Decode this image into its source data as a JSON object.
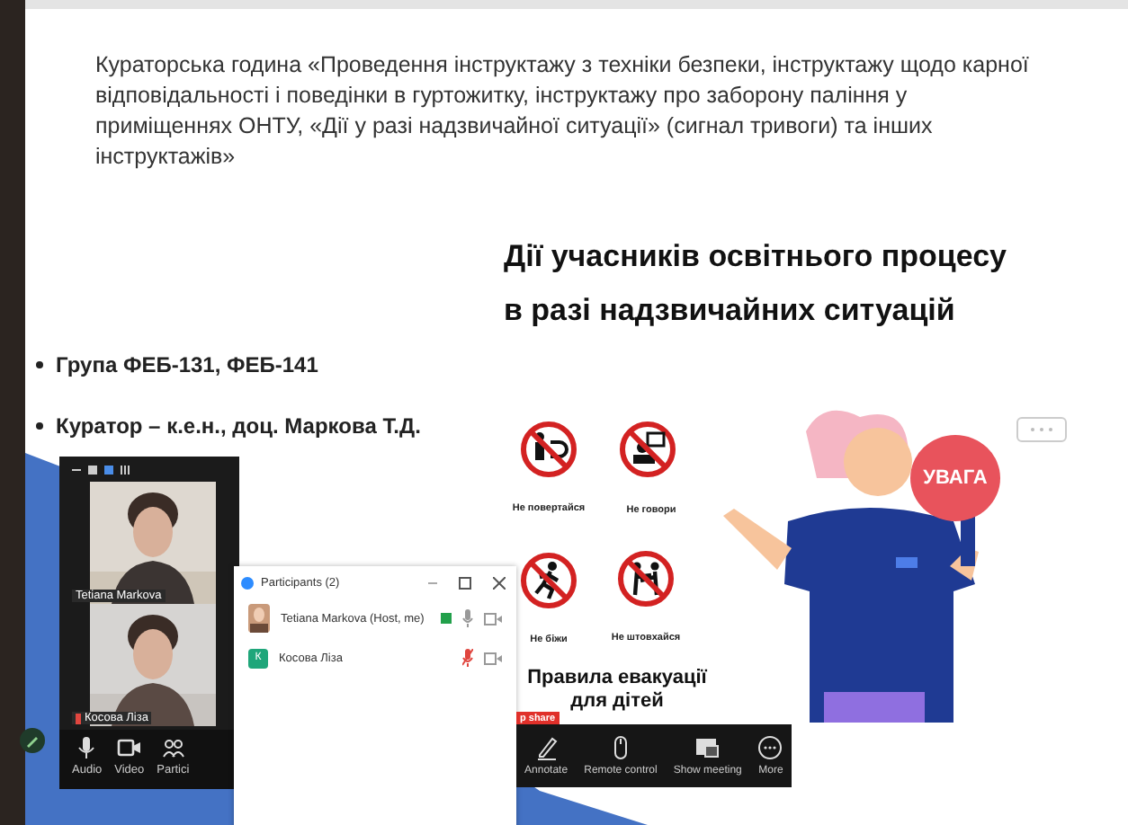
{
  "slide": {
    "intro": "Кураторська година «Проведення інструктажу з техніки безпеки, інструктажу щодо карної відповідальності і поведінки в гуртожитку, інструктажу про заборону паління у приміщеннях ОНТУ, «Дії у разі надзвичайної ситуації» (сигнал тривоги) та інших інструктажів»",
    "title": [
      "Дії учасників освітнього процесу",
      "в разі надзвичайних ситуацій"
    ],
    "bullets": [
      "Група ФЕБ-131, ФЕБ-141",
      "Куратор – к.е.н., доц. Маркова Т.Д."
    ],
    "signs": [
      {
        "kind": "turn",
        "label": "Не повертайся"
      },
      {
        "kind": "talk",
        "label": "Не говори"
      },
      {
        "kind": "run",
        "label": "Не біжи"
      },
      {
        "kind": "push",
        "label": "Не штовхайся"
      }
    ],
    "evacuation_title": "Правила евакуації для дітей",
    "poster_sign": "УВАГА"
  },
  "gallery_window": {
    "tiles": [
      {
        "name": "Tetiana Markova",
        "muted": false
      },
      {
        "name": "Косова Ліза",
        "muted": true
      }
    ],
    "controls": [
      {
        "kind": "mic",
        "label": "Audio"
      },
      {
        "kind": "camera",
        "label": "Video"
      },
      {
        "kind": "people",
        "label": "Partici"
      }
    ]
  },
  "participants_window": {
    "title": "Participants (2)",
    "participants": [
      {
        "name": "Tetiana Markova (Host, me)",
        "sharing": true,
        "muted": false
      },
      {
        "name": "Косова Ліза",
        "kind": "letter",
        "initial": "К",
        "sharing": false,
        "muted": true
      }
    ]
  },
  "share_toolbar": {
    "stop_label": "p share",
    "buttons": [
      {
        "kind": "pencil",
        "label": "Annotate"
      },
      {
        "kind": "mouse",
        "label": "Remote control"
      },
      {
        "kind": "screen",
        "label": "Show meeting"
      },
      {
        "kind": "more",
        "label": "More"
      }
    ]
  }
}
